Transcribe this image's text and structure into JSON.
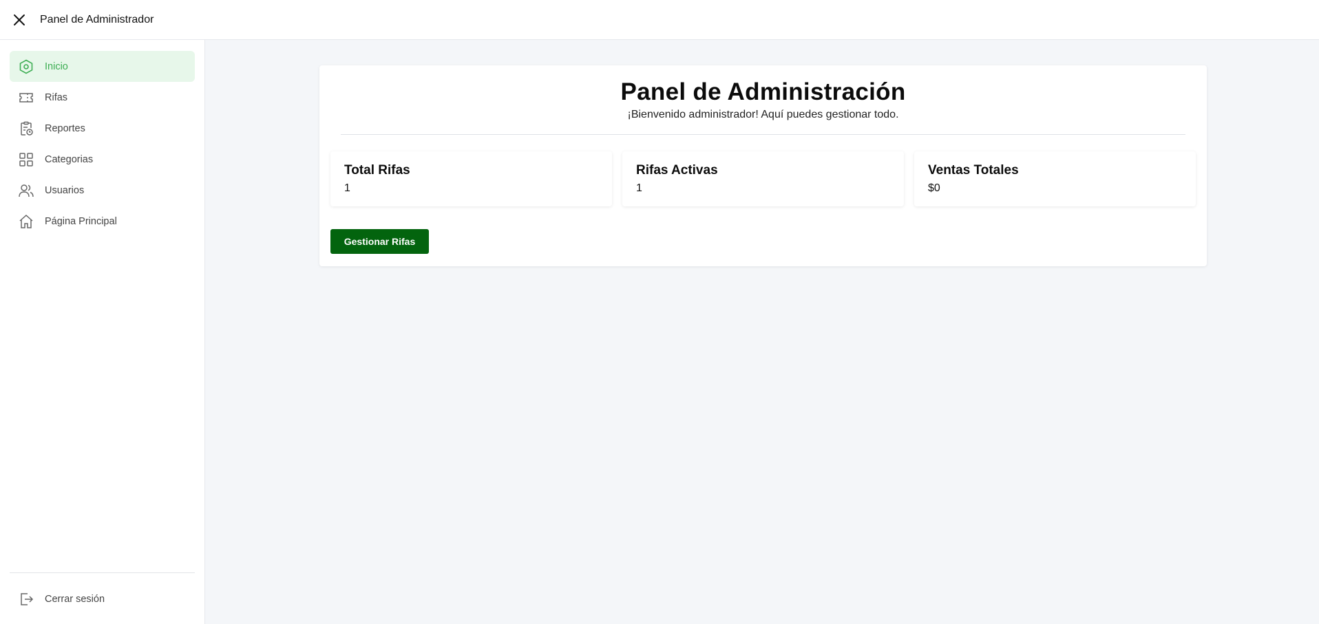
{
  "topbar": {
    "title": "Panel de Administrador",
    "close_icon": "close-icon"
  },
  "sidebar": {
    "items": [
      {
        "label": "Inicio",
        "icon": "hexagon-icon",
        "active": true
      },
      {
        "label": "Rifas",
        "icon": "ticket-icon",
        "active": false
      },
      {
        "label": "Reportes",
        "icon": "clipboard-clock-icon",
        "active": false
      },
      {
        "label": "Categorias",
        "icon": "grid-icon",
        "active": false
      },
      {
        "label": "Usuarios",
        "icon": "users-icon",
        "active": false
      },
      {
        "label": "Página Principal",
        "icon": "home-icon",
        "active": false
      }
    ],
    "logout": {
      "label": "Cerrar sesión",
      "icon": "logout-icon"
    }
  },
  "main": {
    "title": "Panel de Administración",
    "subtitle": "¡Bienvenido administrador! Aquí puedes gestionar todo.",
    "stats": [
      {
        "label": "Total Rifas",
        "value": "1"
      },
      {
        "label": "Rifas Activas",
        "value": "1"
      },
      {
        "label": "Ventas Totales",
        "value": "$0"
      }
    ],
    "manage_button": "Gestionar Rifas"
  },
  "colors": {
    "accent": "#3cad52",
    "active_bg": "#e7f7ea",
    "button": "#03640e",
    "main_bg": "#f4f6f9"
  }
}
